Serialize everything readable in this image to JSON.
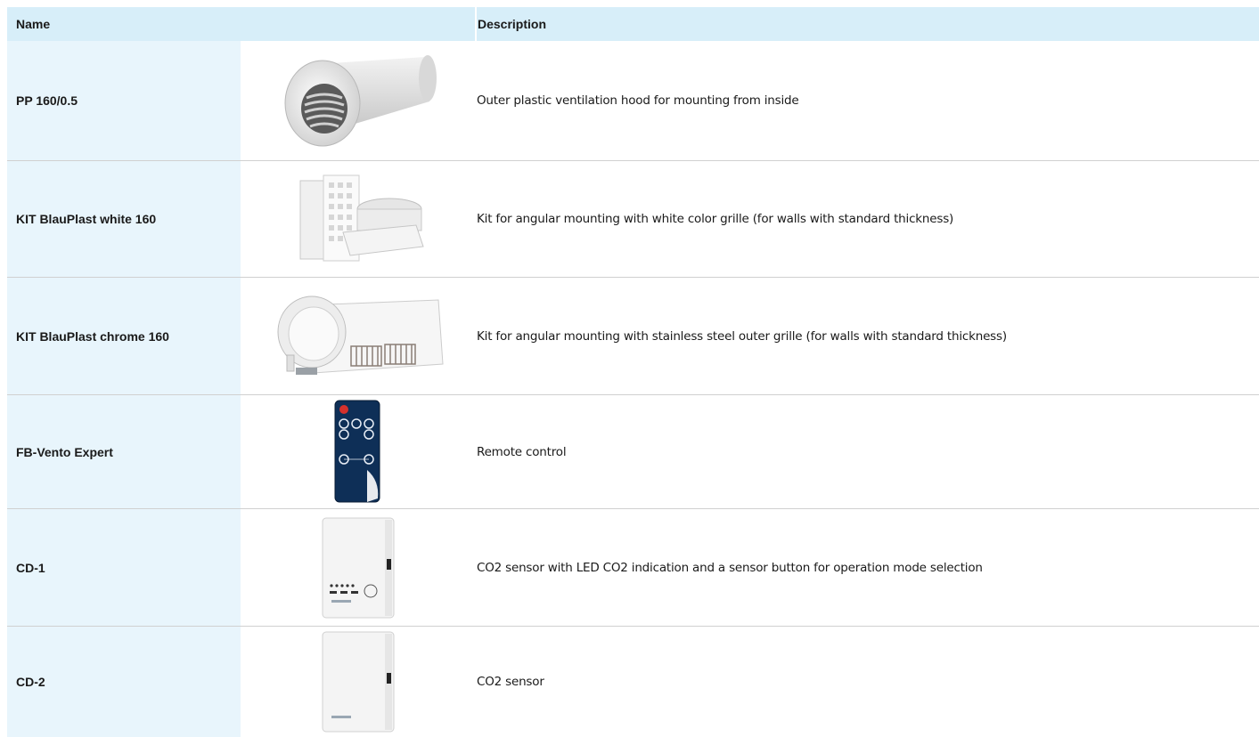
{
  "header": {
    "name": "Name",
    "description": "Description"
  },
  "rows": [
    {
      "name": "PP 160/0.5",
      "description": "Outer plastic ventilation hood for mounting from inside",
      "icon": "ventilation-hood-image"
    },
    {
      "name": "KIT BlauPlast white 160",
      "description": "Kit for angular mounting with white color grille (for walls with standard thickness)",
      "icon": "white-kit-image"
    },
    {
      "name": "KIT BlauPlast chrome 160",
      "description": "Kit for angular mounting with stainless steel outer grille (for walls with standard thickness)",
      "icon": "chrome-kit-image"
    },
    {
      "name": "FB-Vento Expert",
      "description": "Remote control",
      "icon": "remote-control-image"
    },
    {
      "name": "CD-1",
      "description": "CO2 sensor with LED CO2 indication and a sensor button for operation mode selection",
      "icon": "co2-sensor-led-image"
    },
    {
      "name": "CD-2",
      "description": "CO2 sensor",
      "icon": "co2-sensor-image"
    }
  ]
}
